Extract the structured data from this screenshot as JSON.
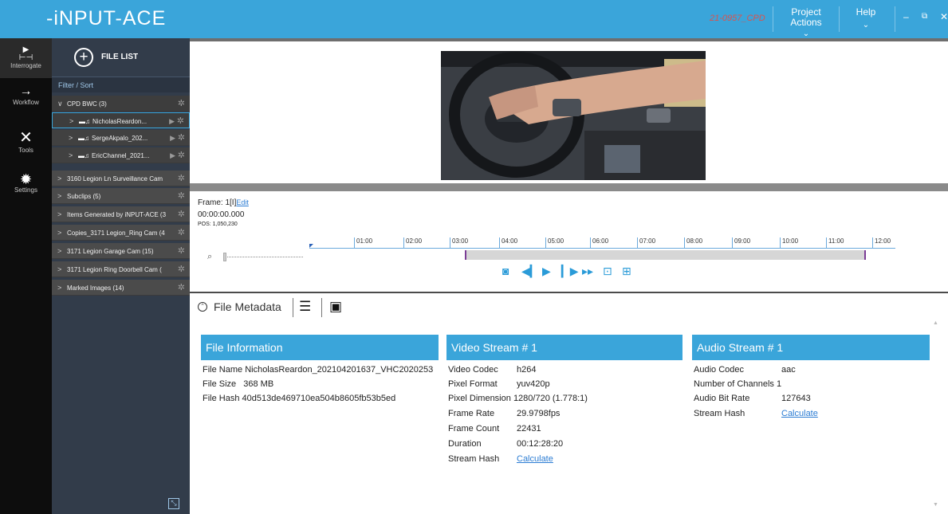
{
  "app": {
    "logo_text": "-iNPUT-ACE",
    "case_id": "21-0957_CPD",
    "menus": [
      {
        "line1": "Project",
        "line2": "Actions"
      },
      {
        "line1": "Help",
        "line2": ""
      }
    ],
    "window_buttons": {
      "minimize": "–",
      "restore": "⧉",
      "close": "✕"
    }
  },
  "rail": {
    "items": [
      {
        "label": "Interrogate",
        "icon": "play-timeline-icon"
      },
      {
        "label": "Workflow",
        "icon": "arrow-right-icon"
      },
      {
        "label": "Tools",
        "icon": "tools-icon"
      },
      {
        "label": "Settings",
        "icon": "gear-icon"
      }
    ]
  },
  "file_panel": {
    "title": "FILE LIST",
    "filter_sort": "Filter / Sort",
    "groups": [
      {
        "label": "CPD BWC (3)",
        "expanded": true,
        "children": [
          "NicholasReardon...",
          "SergeAkpalo_202...",
          "EricChannel_2021..."
        ]
      },
      {
        "label": "3160 Legion Ln Surveillance Cam"
      },
      {
        "label": "Subclips (5)"
      },
      {
        "label": "Items Generated by iNPUT-ACE (3"
      },
      {
        "label": "Copies_3171 Legion_Ring Cam (4"
      },
      {
        "label": "3171 Legion Garage Cam (15)"
      },
      {
        "label": "3171 Legion Ring Doorbell Cam ("
      },
      {
        "label": "Marked Images (14)"
      }
    ]
  },
  "player": {
    "frame_label": "Frame:  1[I]",
    "edit_link": "Edit",
    "timecode": "00:00:00.000",
    "pos": "POS: 1,050,230",
    "ruler_ticks": [
      "01:00",
      "02:00",
      "03:00",
      "04:00",
      "05:00",
      "06:00",
      "07:00",
      "08:00",
      "09:00",
      "10:00",
      "11:00",
      "12:00"
    ]
  },
  "metadata": {
    "title": "File Metadata",
    "file_info": {
      "header": "File Information",
      "rows": [
        {
          "k": "File Name",
          "v": "NicholasReardon_202104201637_VHC2020253"
        },
        {
          "k": "File Size",
          "v": "368 MB"
        },
        {
          "k": "File Hash",
          "v": "40d513de469710ea504b8605fb53b5ed"
        }
      ]
    },
    "video_stream": {
      "header": "Video Stream # 1",
      "rows": [
        {
          "k": "Video Codec",
          "v": "h264"
        },
        {
          "k": "Pixel Format",
          "v": "yuv420p"
        },
        {
          "k": "Pixel Dimension",
          "v": "1280/720 (1.778:1)"
        },
        {
          "k": "Frame Rate",
          "v": "29.9798fps"
        },
        {
          "k": "Frame Count",
          "v": "22431"
        },
        {
          "k": "Duration",
          "v": "00:12:28:20"
        },
        {
          "k": "Stream Hash",
          "v": "Calculate"
        }
      ]
    },
    "audio_stream": {
      "header": "Audio Stream # 1",
      "rows": [
        {
          "k": "Audio Codec",
          "v": "aac"
        },
        {
          "k": "Number of Channels",
          "v": "1"
        },
        {
          "k": "Audio Bit Rate",
          "v": "127643"
        },
        {
          "k": "Stream Hash",
          "v": "Calculate"
        }
      ]
    }
  },
  "colors": {
    "accent": "#3aa5da",
    "case_id": "#d9534f",
    "panel_bg": "#323c4a",
    "rail_bg": "#0d0d0d",
    "link": "#2b7cd3",
    "trim_marker": "#7b3c96"
  }
}
